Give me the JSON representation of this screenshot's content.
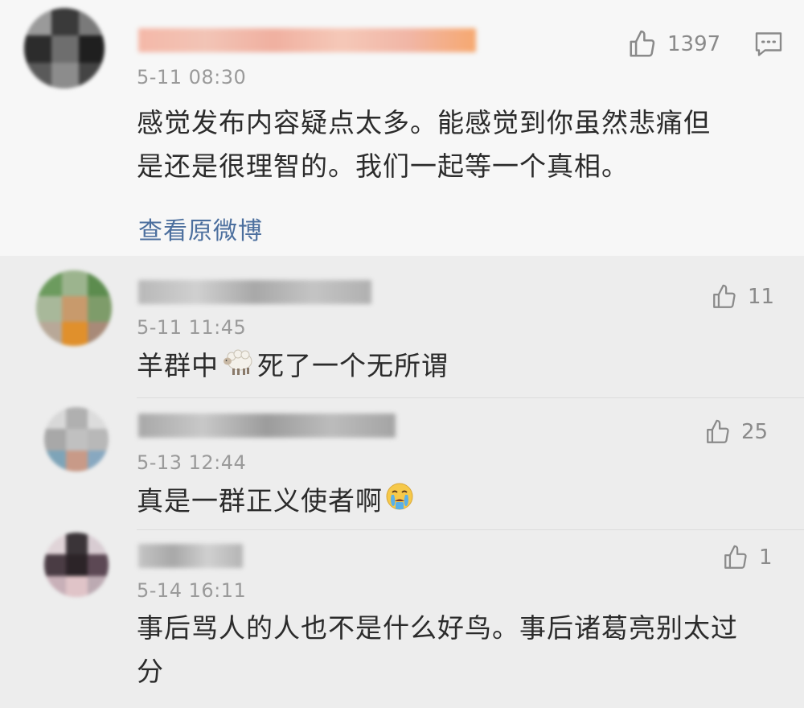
{
  "comment": {
    "timestamp": "5-11 08:30",
    "text_line1": "感觉发布内容疑点太多。能感觉到你虽然悲痛但",
    "text_line2": "是还是很理智的。我们一起等一个真相。",
    "like_count": "1397",
    "view_original": "查看原微博"
  },
  "replies": [
    {
      "timestamp": "5-11 11:45",
      "text_before_emoji": "羊群中",
      "emoji": "sheep-emoji",
      "text_after_emoji": "死了一个无所谓",
      "like_count": "11"
    },
    {
      "timestamp": "5-13 12:44",
      "text": "真是一群正义使者啊",
      "emoji": "crying-face-emoji",
      "like_count": "25"
    },
    {
      "timestamp": "5-14 16:11",
      "text_line1": "事后骂人的人也不是什么好鸟。事后诸葛亮别太过",
      "text_line2": "分",
      "like_count": "1"
    }
  ],
  "colors": {
    "main_bg": "#f7f7f7",
    "reply_bg": "#ededed",
    "link": "#4c6f9e",
    "text": "#2b2b2b",
    "meta": "#9a9a9a"
  }
}
